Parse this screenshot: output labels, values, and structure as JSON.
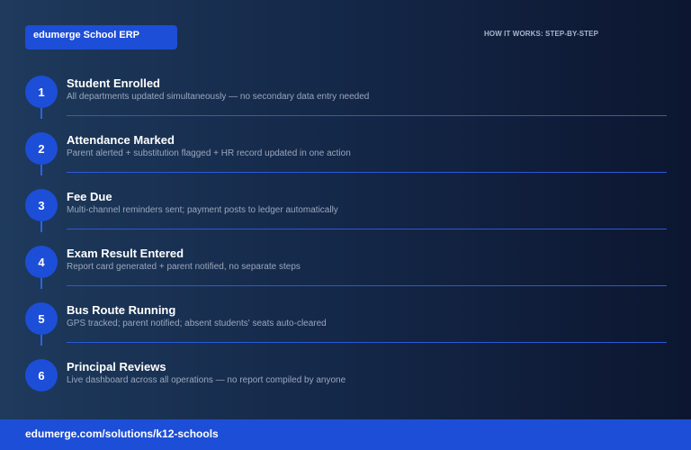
{
  "header": {
    "brand": "edumerge School ERP",
    "tagline": "HOW IT WORKS: STEP-BY-STEP"
  },
  "steps": [
    {
      "number": "1",
      "title": "Student Enrolled",
      "description": "All departments updated simultaneously — no secondary data entry needed"
    },
    {
      "number": "2",
      "title": "Attendance Marked",
      "description": "Parent alerted + substitution flagged + HR record updated in one action"
    },
    {
      "number": "3",
      "title": "Fee Due",
      "description": "Multi-channel reminders sent; payment posts to ledger automatically"
    },
    {
      "number": "4",
      "title": "Exam Result Entered",
      "description": "Report card generated + parent notified, no separate steps"
    },
    {
      "number": "5",
      "title": "Bus Route Running",
      "description": "GPS tracked; parent notified; absent students' seats auto-cleared"
    },
    {
      "number": "6",
      "title": "Principal Reviews",
      "description": "Live dashboard across all operations — no report compiled by anyone"
    }
  ],
  "footer": {
    "url": "edumerge.com/solutions/k12-schools"
  },
  "colors": {
    "accent": "#1d4ed8",
    "divider": "#2a59d8",
    "background_dark": "#0c1630"
  }
}
